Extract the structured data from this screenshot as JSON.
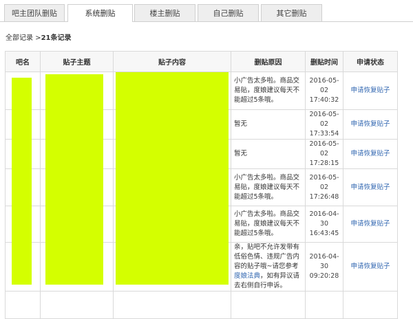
{
  "tabs": [
    {
      "label": "吧主团队删贴"
    },
    {
      "label": "系统删贴"
    },
    {
      "label": "楼主删贴"
    },
    {
      "label": "自己删贴"
    },
    {
      "label": "其它删贴"
    }
  ],
  "summary": {
    "prefix": "全部记录 >",
    "count": "21条记录"
  },
  "table": {
    "headers": [
      "吧名",
      "贴子主题",
      "贴子内容",
      "删贴原因",
      "删贴时间",
      "申请状态"
    ],
    "rows": [
      {
        "reason": "小广告太多啦。商品交易贴，度娘建议每天不能超过5条哦。",
        "date": "2016-05-02",
        "time": "17:40:32",
        "action": "申请恢复贴子"
      },
      {
        "reason": "暂无",
        "date": "2016-05-02",
        "time": "17:33:54",
        "action": "申请恢复贴子"
      },
      {
        "reason": "暂无",
        "date": "2016-05-02",
        "time": "17:28:15",
        "action": "申请恢复贴子"
      },
      {
        "reason": "小广告太多啦。商品交易贴，度娘建议每天不能超过5条哦。",
        "date": "2016-05-02",
        "time": "17:26:48",
        "action": "申请恢复贴子"
      },
      {
        "reason": "小广告太多啦。商品交易贴，度娘建议每天不能超过5条哦。",
        "date": "2016-04-30",
        "time": "16:43:45",
        "action": "申请恢复贴子"
      },
      {
        "reason_pre": "亲，贴吧不允许发带有低俗色情、违规广告内容的贴子哦~请您参考",
        "reason_link": "度娘法典",
        "reason_post": "，如有异议请去右侧自行申诉。",
        "date": "2016-04-30",
        "time": "09:20:28",
        "action": "申请恢复贴子"
      }
    ]
  },
  "colors": {
    "redaction": "#d4ff00",
    "link": "#3066b0"
  }
}
